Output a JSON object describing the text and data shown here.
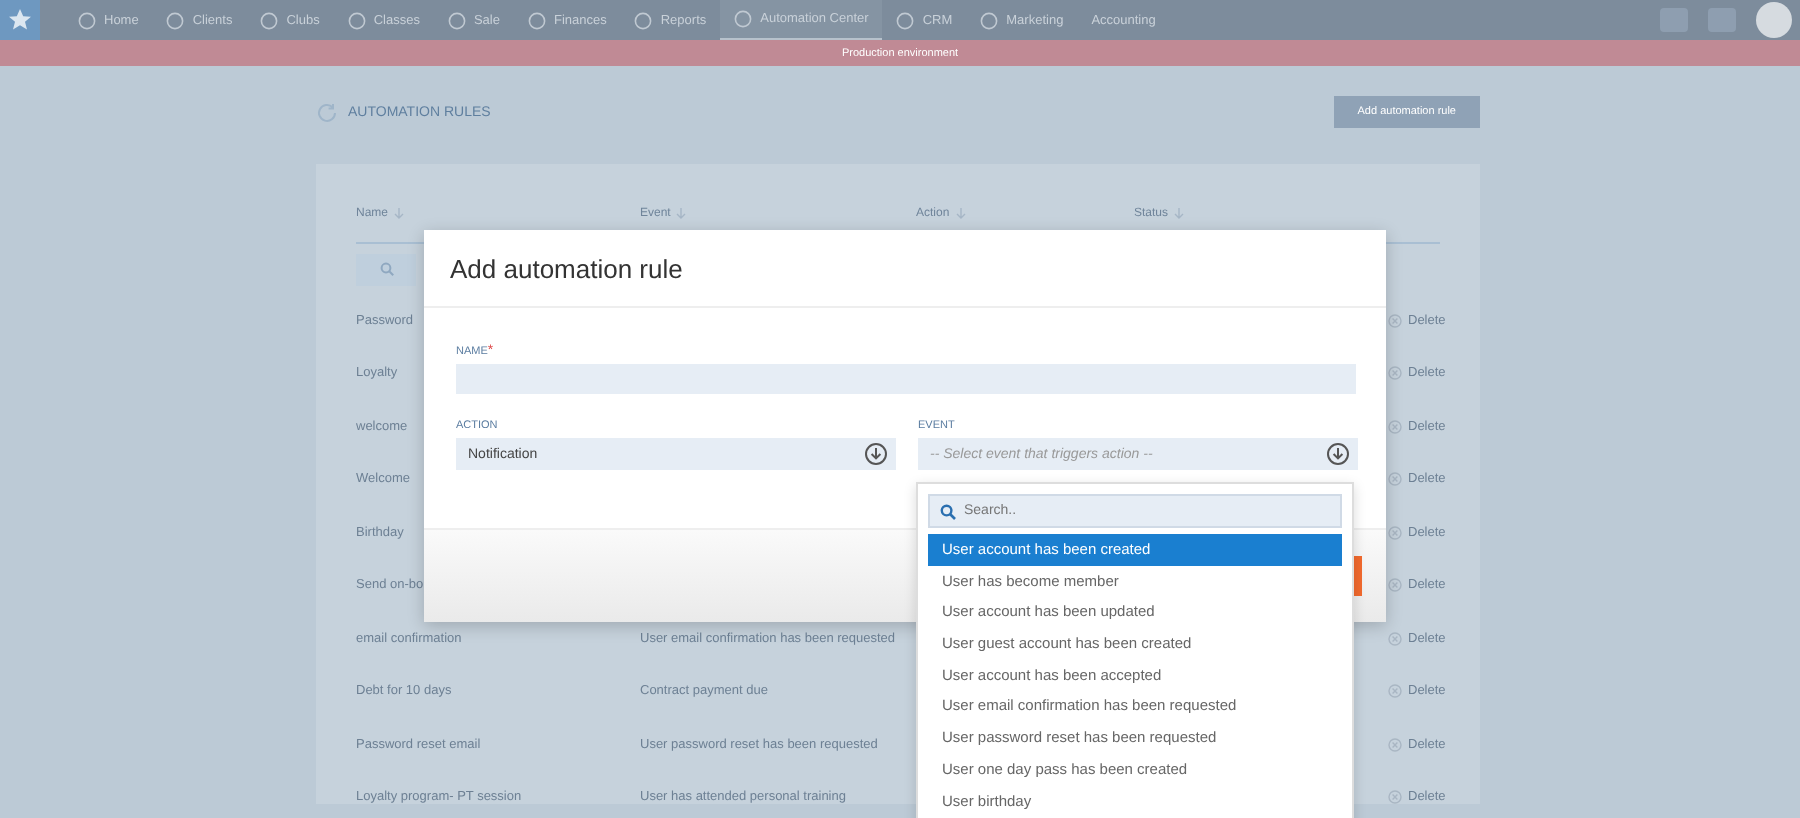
{
  "nav": {
    "items": [
      {
        "label": "Home",
        "kind": "with-icon",
        "selected": false
      },
      {
        "label": "Clients",
        "kind": "with-icon",
        "selected": false
      },
      {
        "label": "Clubs",
        "kind": "with-icon",
        "selected": false
      },
      {
        "label": "Classes",
        "kind": "with-icon",
        "selected": false
      },
      {
        "label": "Sale",
        "kind": "with-icon",
        "selected": false
      },
      {
        "label": "Finances",
        "kind": "with-icon",
        "selected": false
      },
      {
        "label": "Reports",
        "kind": "with-icon",
        "selected": false
      },
      {
        "label": "Automation Center",
        "kind": "with-icon",
        "selected": true
      },
      {
        "label": "CRM",
        "kind": "with-icon",
        "selected": false
      },
      {
        "label": "Marketing",
        "kind": "with-icon",
        "selected": false
      },
      {
        "label": "Accounting",
        "kind": "plain",
        "selected": false
      }
    ]
  },
  "banner": "Production environment",
  "page": {
    "title": "AUTOMATION RULES",
    "add_button": "Add automation rule"
  },
  "table": {
    "columns": [
      "Name",
      "Event",
      "Action",
      "Status"
    ],
    "rows": [
      {
        "name": "Password",
        "delete": "Delete"
      },
      {
        "name": "Loyalty",
        "delete": "Delete"
      },
      {
        "name": "welcome",
        "delete": "Delete"
      },
      {
        "name": "Welcome",
        "delete": "Delete"
      },
      {
        "name": "Birthday",
        "delete": "Delete"
      },
      {
        "name": "Send on-bo",
        "delete": "Delete"
      },
      {
        "name": "email confirmation",
        "event": "User email confirmation has been requested",
        "delete": "Delete"
      },
      {
        "name": "Debt for 10 days",
        "event": "Contract payment due",
        "delete": "Delete"
      },
      {
        "name": "Password reset email",
        "event": "User password reset has been requested",
        "delete": "Delete"
      },
      {
        "name": "Loyalty program- PT session",
        "event": "User has attended personal training",
        "delete": "Delete"
      }
    ]
  },
  "modal": {
    "title": "Add automation rule",
    "name_field": {
      "label": "NAME",
      "required_mark": "*"
    },
    "action_field": {
      "label": "ACTION",
      "value": "Notification"
    },
    "event_field": {
      "label": "EVENT",
      "placeholder": "-- Select event that triggers action --"
    },
    "dropdown": {
      "search_placeholder": "Search..",
      "options": [
        {
          "label": "User account has been created",
          "selected": true
        },
        {
          "label": "User has become member",
          "selected": false
        },
        {
          "label": "User account has been updated",
          "selected": false
        },
        {
          "label": "User guest account has been created",
          "selected": false
        },
        {
          "label": "User account has been accepted",
          "selected": false
        },
        {
          "label": "User email confirmation has been requested",
          "selected": false
        },
        {
          "label": "User password reset has been requested",
          "selected": false
        },
        {
          "label": "User one day pass has been created",
          "selected": false
        },
        {
          "label": "User birthday",
          "selected": false
        }
      ]
    }
  }
}
